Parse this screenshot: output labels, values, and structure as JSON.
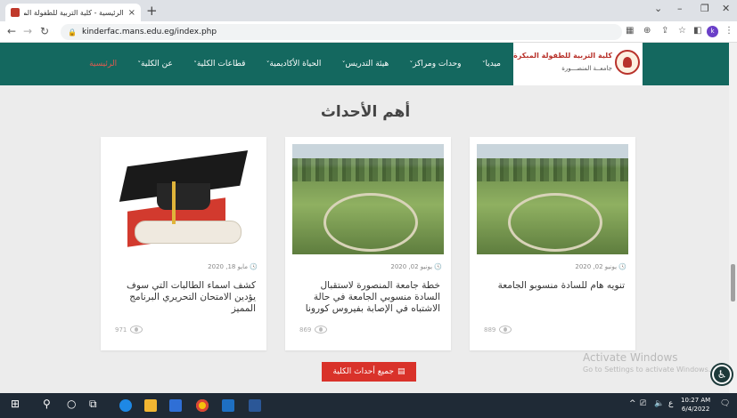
{
  "browser": {
    "tab_title": "الرئيسية - كلية التربية للطفولة المبكرة",
    "close_tab": "×",
    "new_tab": "+",
    "url": "kinderfac.mans.edu.eg/index.php",
    "profile_initial": "k"
  },
  "site": {
    "brand_title": "كلية التربية للطفولة المبكرة",
    "brand_subtitle": "جامعــة المنصـــورة",
    "menu": [
      {
        "label": "الرئيسية",
        "caret": ""
      },
      {
        "label": "عن الكلية",
        "caret": "˅"
      },
      {
        "label": "قطاعات الكلية",
        "caret": "˅"
      },
      {
        "label": "الحياة الأكاديمية",
        "caret": "˅"
      },
      {
        "label": "هيئة التدريس",
        "caret": "˅"
      },
      {
        "label": "وحدات ومراكز",
        "caret": "˅"
      },
      {
        "label": "ميديا",
        "caret": "˅"
      }
    ]
  },
  "events": {
    "title": "أهم الأحداث",
    "cards": [
      {
        "date": "يونيو 02, 2020",
        "text": "تنويه هام للسادة منسوبو الجامعة",
        "views": "889"
      },
      {
        "date": "يونيو 02, 2020",
        "text": "خطة جامعة المنصورة لاستقبال السادة منسوبي الجامعة في حالة الاشتباه في الإصابة بفيروس كورونا",
        "views": "869"
      },
      {
        "date": "مايو 18, 2020",
        "text": "كشف اسماء الطالبات التي سوف يؤدين الامتحان التحريري البرنامج المميز",
        "views": "971"
      }
    ],
    "all_button": "جميع أحداث الكلية"
  },
  "watermark": {
    "line1": "Activate Windows",
    "line2": "Go to Settings to activate Windows."
  },
  "taskbar": {
    "time": "10:27 AM",
    "date": "6/4/2022"
  }
}
